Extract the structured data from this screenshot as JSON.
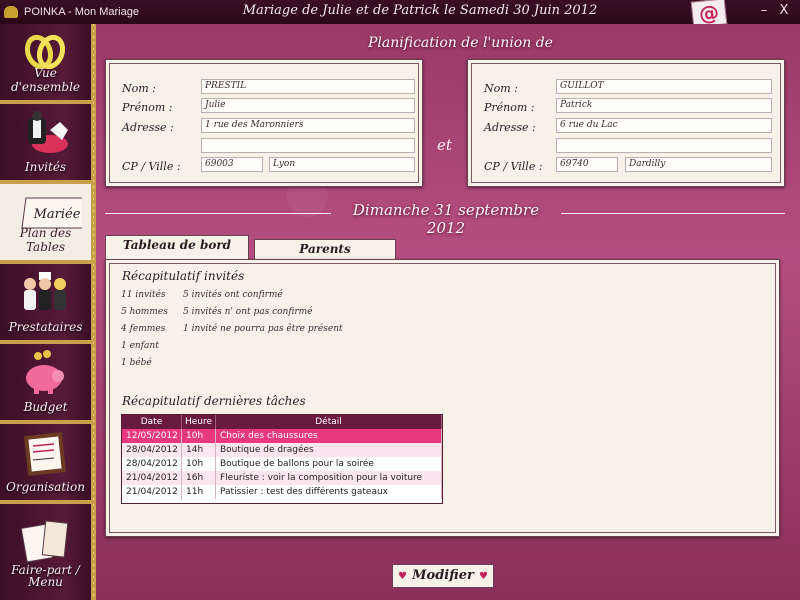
{
  "titlebar": {
    "app_name": "POINKA - Mon Mariage",
    "title": "Mariage de Julie et de Patrick le Samedi 30 Juin 2012",
    "email_label": "@",
    "minimize": "–",
    "close": "X"
  },
  "sidebar": {
    "items": [
      {
        "label": "Vue d'ensemble",
        "icon": "rings-icon"
      },
      {
        "label": "Invités",
        "icon": "guests-icon"
      },
      {
        "label": "Plan des Tables",
        "icon": "table-card-icon",
        "card_text": "Mariée"
      },
      {
        "label": "Prestataires",
        "icon": "providers-icon"
      },
      {
        "label": "Budget",
        "icon": "piggy-bank-icon"
      },
      {
        "label": "Organisation",
        "icon": "clipboard-icon"
      },
      {
        "label": "Faire-part / Menu",
        "icon": "invitation-icon"
      }
    ]
  },
  "union": {
    "title": "Planification de l'union de",
    "and_label": "et",
    "labels": {
      "nom": "Nom :",
      "prenom": "Prénom :",
      "adresse": "Adresse :",
      "cp_ville": "CP / Ville :"
    },
    "person1": {
      "nom": "PRESTIL",
      "prenom": "Julie",
      "adresse": "1 rue des Maronniers",
      "adresse2": "",
      "cp": "69003",
      "ville": "Lyon"
    },
    "person2": {
      "nom": "GUILLOT",
      "prenom": "Patrick",
      "adresse": "6 rue du Lac",
      "adresse2": "",
      "cp": "69740",
      "ville": "Dardilly"
    }
  },
  "date_title": "Dimanche 31 septembre 2012",
  "tabs": [
    {
      "label": "Tableau de bord",
      "active": true
    },
    {
      "label": "Parents",
      "active": false
    }
  ],
  "dashboard": {
    "guests_title": "Récapitulatif invités",
    "guests_left": [
      "11 invités",
      "5 hommes",
      "4 femmes",
      "1 enfant",
      "1 bébé"
    ],
    "guests_right": [
      "5 invités ont confirmé",
      "5 invités n' ont pas confirmé",
      "1 invité ne pourra pas être présent"
    ],
    "tasks_title": "Récapitulatif dernières tâches",
    "tasks_columns": [
      "Date",
      "Heure",
      "Détail"
    ],
    "tasks": [
      {
        "date": "12/05/2012",
        "heure": "10h",
        "detail": "Choix des chaussures"
      },
      {
        "date": "28/04/2012",
        "heure": "14h",
        "detail": "Boutique de dragées"
      },
      {
        "date": "28/04/2012",
        "heure": "10h",
        "detail": "Boutique de ballons pour la soirée"
      },
      {
        "date": "21/04/2012",
        "heure": "16h",
        "detail": "Fleuriste : voir la composition pour la voiture"
      },
      {
        "date": "21/04/2012",
        "heure": "11h",
        "detail": "Patissier : test des différents gateaux"
      }
    ]
  },
  "modify_button": "Modifier",
  "colors": {
    "accent": "#c0245a",
    "sidebar": "#561a37",
    "selected_row": "#e8387e",
    "header": "#6a1a3f"
  }
}
